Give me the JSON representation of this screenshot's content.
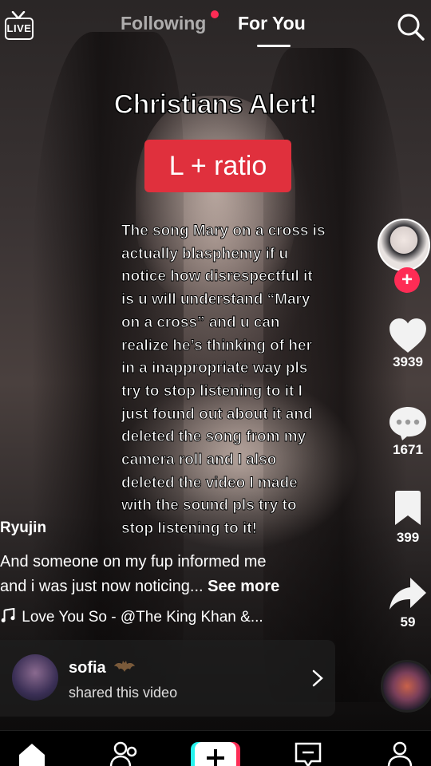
{
  "top": {
    "live_label": "LIVE",
    "tabs": [
      {
        "label": "Following",
        "active": false
      },
      {
        "label": "For You",
        "active": true
      }
    ]
  },
  "overlay": {
    "title": "Christians Alert!",
    "badge": "L + ratio",
    "badge_color": "#e0303d",
    "body_lines": [
      "The song Mary on a cross is",
      "actually blasphemy if u",
      "notice how disrespectful it",
      "is u will understand “Mary",
      "on a cross” and u can",
      "realize he’s thinking of her",
      "in a inappropriate way pls",
      "try to stop listening to it I",
      "just found out about it and",
      "deleted the song from my",
      "camera roll and I also",
      "deleted the video I made",
      "with the sound pls try to",
      "stop listening to it!"
    ]
  },
  "rail": {
    "likes": "3939",
    "comments": "1671",
    "saves": "399",
    "shares": "59",
    "follow_plus": "+"
  },
  "post": {
    "author": "Ryujin",
    "caption_line1": "And someone on my fup informed me",
    "caption_line2": "and i was just now noticing... ",
    "see_more": "See more",
    "music": "Love You So - @The King Khan &..."
  },
  "shared": {
    "name": "sofia",
    "subtitle": "shared this video"
  },
  "colors": {
    "accent": "#fe2c55",
    "live_dot": "#fe2c55"
  },
  "nav": {
    "items": [
      "home-icon",
      "friends-icon",
      "create-icon",
      "inbox-icon",
      "profile-icon"
    ]
  }
}
